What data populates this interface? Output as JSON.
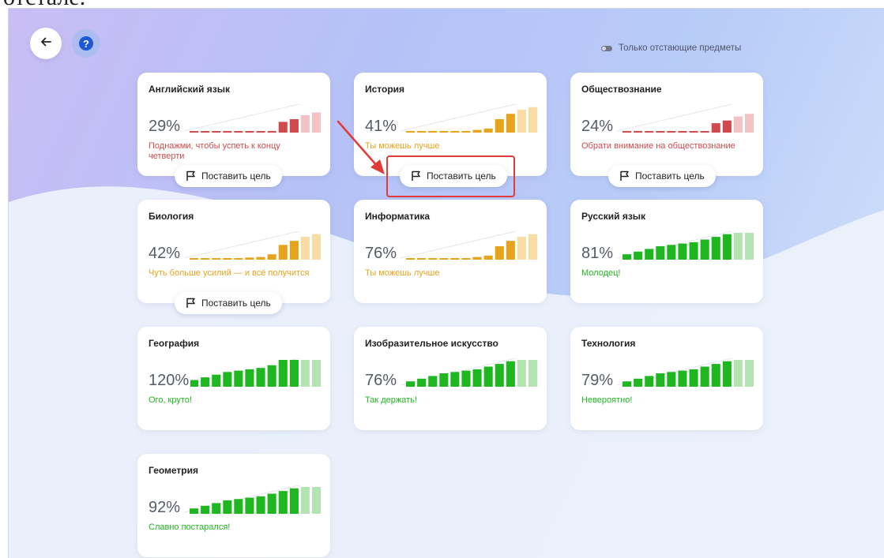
{
  "caption": {
    "text": "отсталe."
  },
  "toolbar": {
    "back_icon": "arrow-left-icon",
    "help_icon": "question-icon",
    "help_glyph": "?"
  },
  "filter": {
    "label": "Только отстающие предметы",
    "icon": "toggle-icon",
    "enabled": false
  },
  "goal_button_label": "Поставить цель",
  "colors": {
    "red": "#d04a4d",
    "red_light": "#f3c2c4",
    "orange": "#e8a31c",
    "orange_light": "#f8dca4",
    "green": "#1fb71f",
    "green_light": "#b3e3b0",
    "annotation": "#e23a36"
  },
  "subjects": [
    {
      "name": "Английский язык",
      "percent": "29%",
      "message": "Поднажми, чтобы успеть к концу четверти",
      "status": "red",
      "bars": [
        0.03,
        0.03,
        0.03,
        0.03,
        0.03,
        0.03,
        0.03,
        0.03,
        0.4,
        0.5,
        0.65,
        0.75
      ],
      "solid_count": 10,
      "goal_button": true
    },
    {
      "name": "История",
      "percent": "41%",
      "message": "Ты можешь лучше",
      "status": "orange",
      "bars": [
        0.03,
        0.03,
        0.03,
        0.03,
        0.03,
        0.05,
        0.1,
        0.15,
        0.5,
        0.7,
        0.85,
        0.95
      ],
      "solid_count": 10,
      "goal_button": true,
      "highlighted": true
    },
    {
      "name": "Обществознание",
      "percent": "24%",
      "message": "Обрати внимание на обществознание",
      "status": "red",
      "bars": [
        0.03,
        0.03,
        0.03,
        0.03,
        0.03,
        0.03,
        0.03,
        0.03,
        0.35,
        0.45,
        0.6,
        0.7
      ],
      "solid_count": 10,
      "goal_button": true
    },
    {
      "name": "Биология",
      "percent": "42%",
      "message": "Чуть больше усилий — и всё получится",
      "status": "orange",
      "bars": [
        0.03,
        0.03,
        0.03,
        0.03,
        0.05,
        0.08,
        0.1,
        0.2,
        0.55,
        0.7,
        0.85,
        0.95
      ],
      "solid_count": 10,
      "goal_button": true
    },
    {
      "name": "Информатика",
      "percent": "76%",
      "message": "Ты можешь лучше",
      "status": "orange",
      "bars": [
        0.03,
        0.03,
        0.03,
        0.03,
        0.03,
        0.06,
        0.1,
        0.15,
        0.5,
        0.7,
        0.85,
        0.95
      ],
      "solid_count": 10,
      "goal_button": false
    },
    {
      "name": "Русский язык",
      "percent": "81%",
      "message": "Молодец!",
      "status": "green",
      "bars": [
        0.2,
        0.3,
        0.4,
        0.5,
        0.55,
        0.6,
        0.65,
        0.75,
        0.85,
        0.95,
        1.0,
        1.0
      ],
      "solid_count": 10,
      "goal_button": false
    },
    {
      "name": "География",
      "percent": "120%",
      "message": "Ого, круто!",
      "status": "green",
      "bars": [
        0.25,
        0.35,
        0.45,
        0.55,
        0.6,
        0.65,
        0.7,
        0.8,
        1.0,
        1.0,
        1.0,
        1.0
      ],
      "solid_count": 10,
      "goal_button": false
    },
    {
      "name": "Изобразительное искусство",
      "percent": "76%",
      "message": "Так держать!",
      "status": "green",
      "bars": [
        0.2,
        0.3,
        0.4,
        0.5,
        0.55,
        0.6,
        0.65,
        0.75,
        0.85,
        0.95,
        1.0,
        1.0
      ],
      "solid_count": 10,
      "goal_button": false
    },
    {
      "name": "Технология",
      "percent": "79%",
      "message": "Невероятно!",
      "status": "green",
      "bars": [
        0.2,
        0.3,
        0.4,
        0.5,
        0.55,
        0.6,
        0.65,
        0.75,
        0.85,
        0.95,
        1.0,
        1.0
      ],
      "solid_count": 10,
      "goal_button": false
    },
    {
      "name": "Геометрия",
      "percent": "92%",
      "message": "Славно постарался!",
      "status": "green",
      "bars": [
        0.2,
        0.3,
        0.4,
        0.5,
        0.55,
        0.6,
        0.65,
        0.75,
        0.85,
        0.95,
        1.0,
        1.0
      ],
      "solid_count": 10,
      "goal_button": false
    }
  ]
}
